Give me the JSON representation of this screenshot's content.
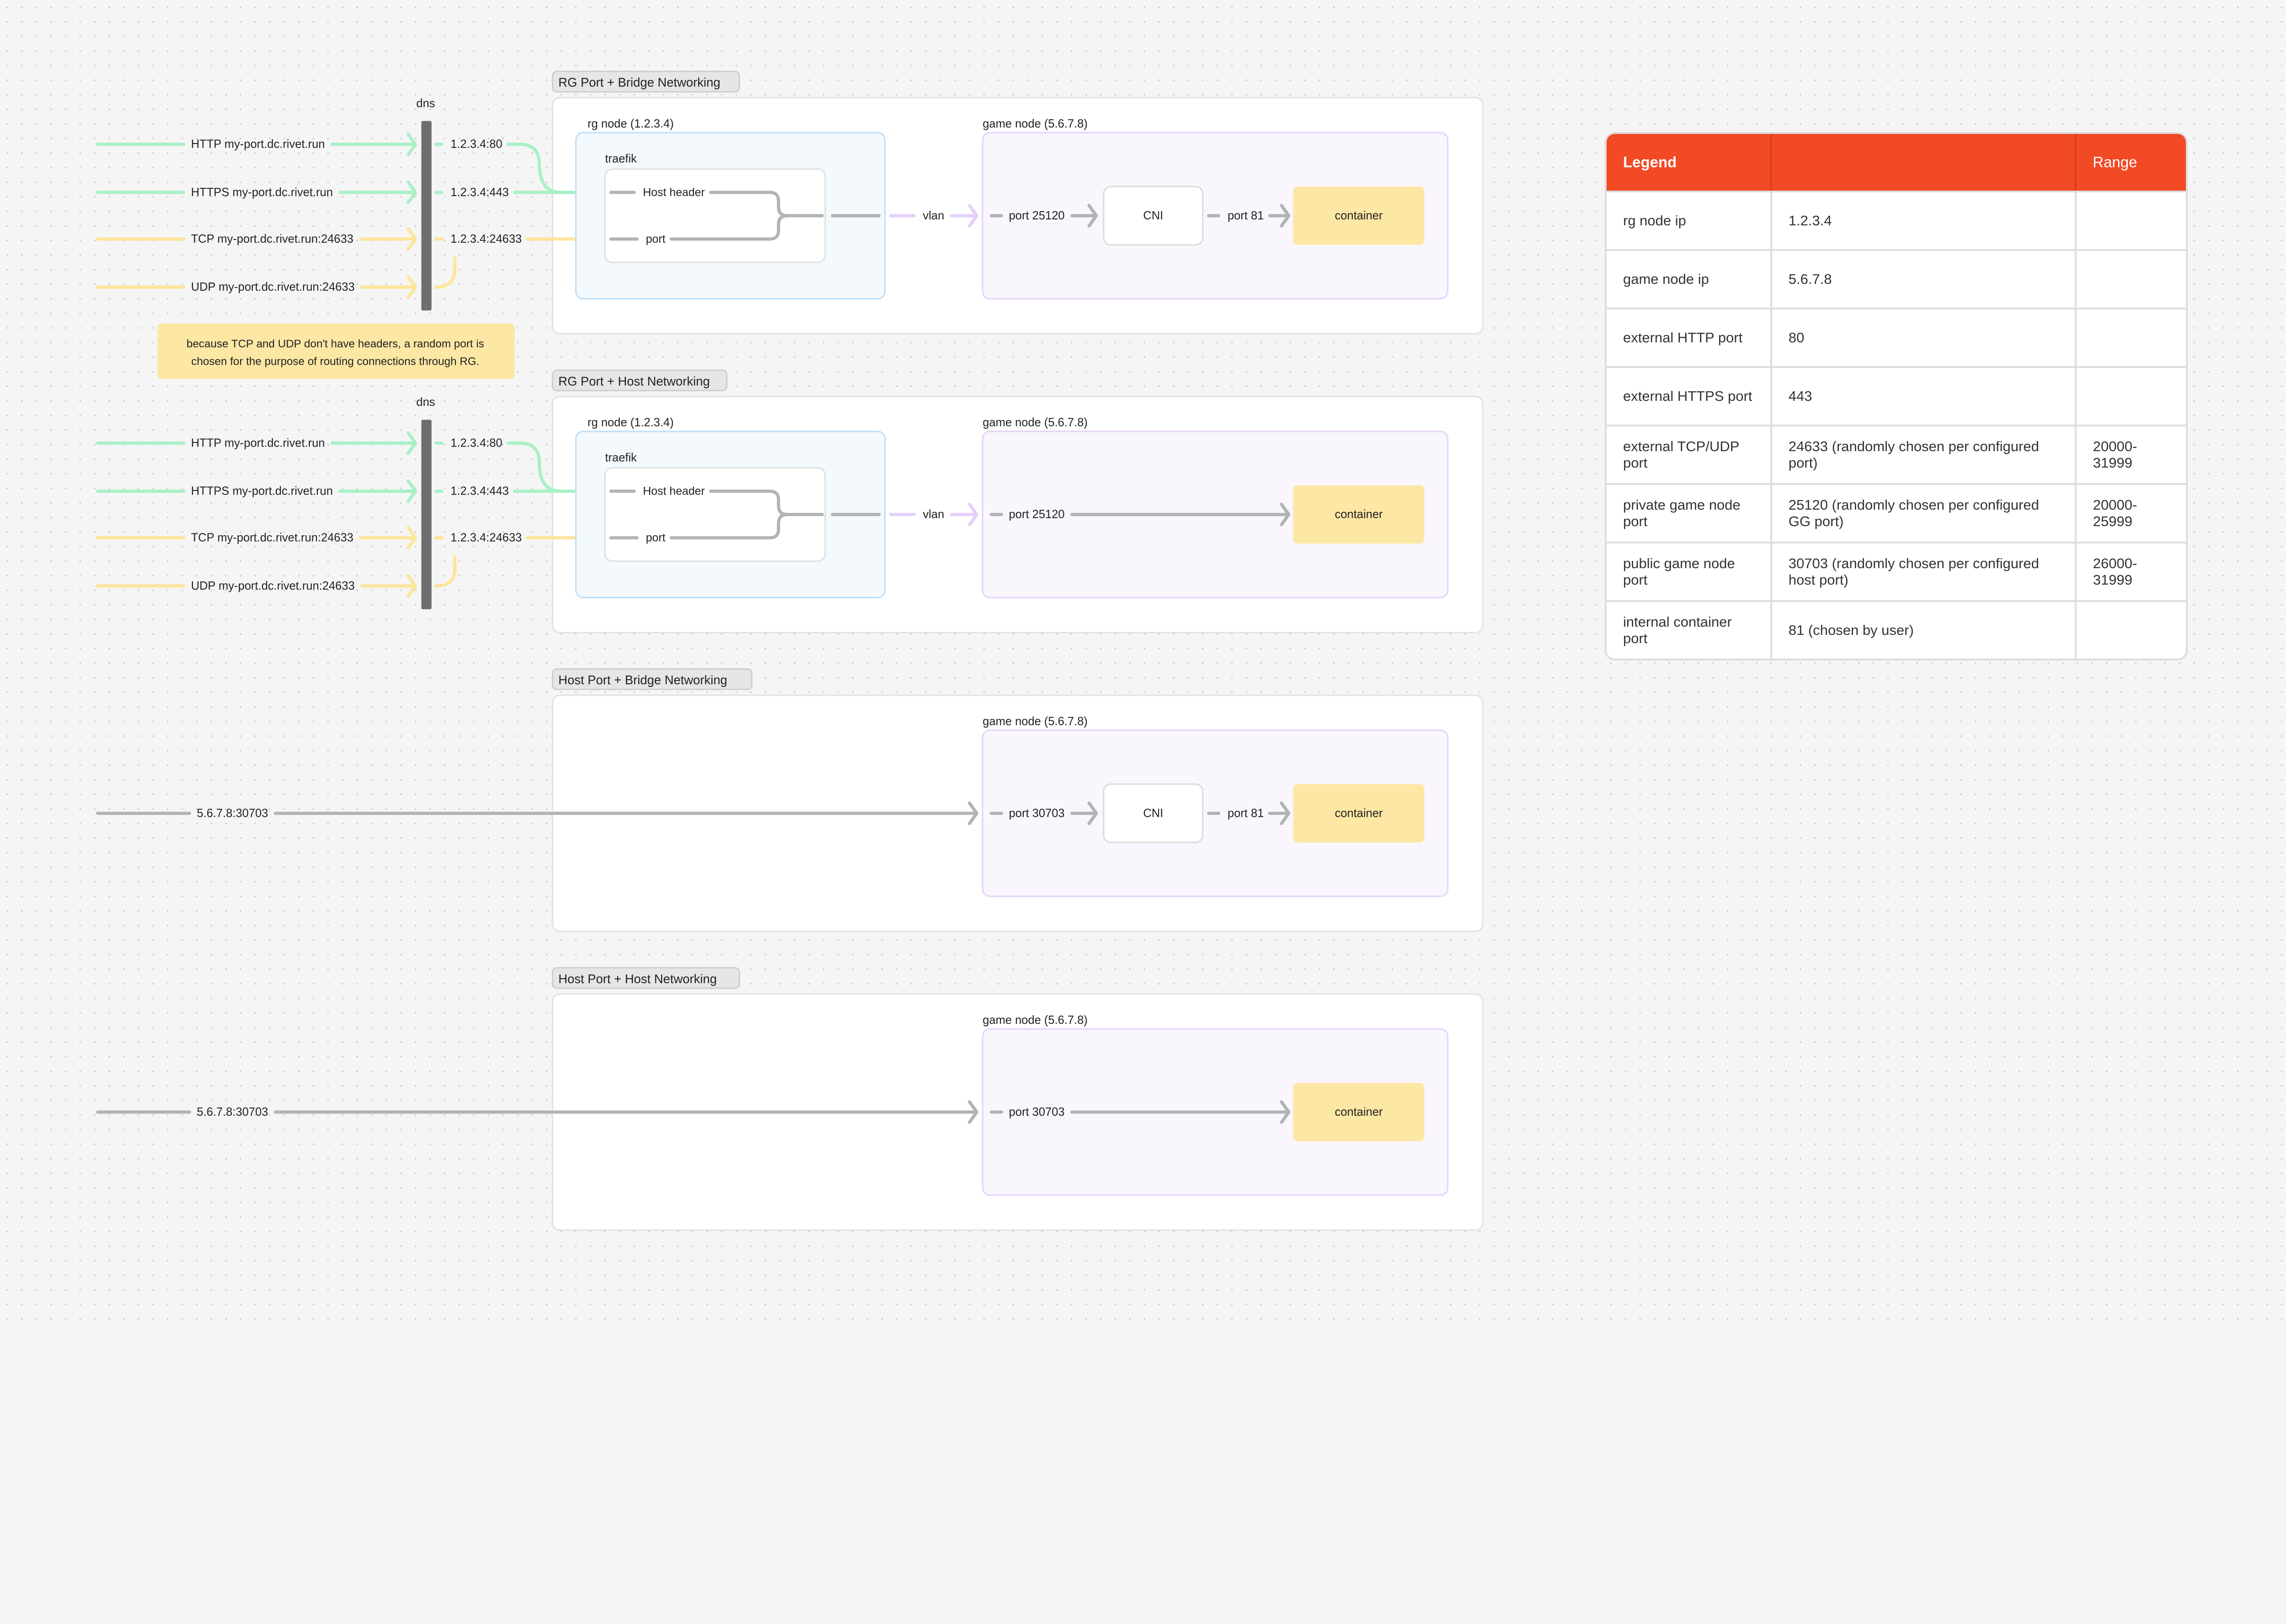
{
  "colors": {
    "http": "#a8f0c6",
    "tcp": "#fde59a",
    "gray": "#b3b3b3",
    "vlan": "#e4cffb",
    "rg_fill": "#f4f9fe",
    "rg_border": "#bfe0f8",
    "game_fill": "#f9f6fe",
    "game_border": "#e6d3fa",
    "container": "#fde7a4",
    "accent": "#f24a24"
  },
  "sections": [
    {
      "title": "RG Port + Bridge Networking",
      "dns_label": "dns",
      "requests": [
        {
          "label": "HTTP my-port.dc.rivet.run",
          "kind": "http",
          "ip": "1.2.3.4:80"
        },
        {
          "label": "HTTPS my-port.dc.rivet.run",
          "kind": "http",
          "ip": "1.2.3.4:443"
        },
        {
          "label": "TCP my-port.dc.rivet.run:24633",
          "kind": "tcp",
          "ip": "1.2.3.4:24633"
        },
        {
          "label": "UDP my-port.dc.rivet.run:24633",
          "kind": "tcp",
          "ip": ""
        }
      ],
      "rg_node": "rg node (1.2.3.4)",
      "traefik": "traefik",
      "traefik_inputs": [
        "Host header",
        "port"
      ],
      "vlan": "vlan",
      "game_node": "game node (5.6.7.8)",
      "node_port": "port 25120",
      "cni": "CNI",
      "container_port": "port 81",
      "container": "container"
    },
    {
      "title": "RG Port + Host Networking",
      "dns_label": "dns",
      "requests": [
        {
          "label": "HTTP my-port.dc.rivet.run",
          "kind": "http",
          "ip": "1.2.3.4:80"
        },
        {
          "label": "HTTPS my-port.dc.rivet.run",
          "kind": "http",
          "ip": "1.2.3.4:443"
        },
        {
          "label": "TCP my-port.dc.rivet.run:24633",
          "kind": "tcp",
          "ip": "1.2.3.4:24633"
        },
        {
          "label": "UDP my-port.dc.rivet.run:24633",
          "kind": "tcp",
          "ip": ""
        }
      ],
      "rg_node": "rg node (1.2.3.4)",
      "traefik": "traefik",
      "traefik_inputs": [
        "Host header",
        "port"
      ],
      "vlan": "vlan",
      "game_node": "game node (5.6.7.8)",
      "node_port": "port 25120",
      "container": "container"
    },
    {
      "title": "Host Port + Bridge Networking",
      "direct": "5.6.7.8:30703",
      "game_node": "game node (5.6.7.8)",
      "node_port": "port 30703",
      "cni": "CNI",
      "container_port": "port 81",
      "container": "container"
    },
    {
      "title": "Host Port + Host Networking",
      "direct": "5.6.7.8:30703",
      "game_node": "game node (5.6.7.8)",
      "node_port": "port 30703",
      "container": "container"
    }
  ],
  "note": [
    "because TCP and UDP don't have headers, a random port is",
    "chosen for the purpose of routing connections through RG."
  ],
  "legend": {
    "headers": [
      "Legend",
      "",
      "Range"
    ],
    "rows": [
      [
        "rg node ip",
        "1.2.3.4",
        ""
      ],
      [
        "game node ip",
        "5.6.7.8",
        ""
      ],
      [
        "external HTTP port",
        "80",
        ""
      ],
      [
        "external HTTPS port",
        "443",
        ""
      ],
      [
        "external TCP/UDP port",
        "24633 (randomly chosen per configured port)",
        "20000-31999"
      ],
      [
        "private game node port",
        "25120 (randomly chosen per configured GG port)",
        "20000-25999"
      ],
      [
        "public game node port",
        "30703 (randomly chosen per configured host port)",
        "26000-31999"
      ],
      [
        "internal container port",
        "81 (chosen by user)",
        ""
      ]
    ]
  }
}
